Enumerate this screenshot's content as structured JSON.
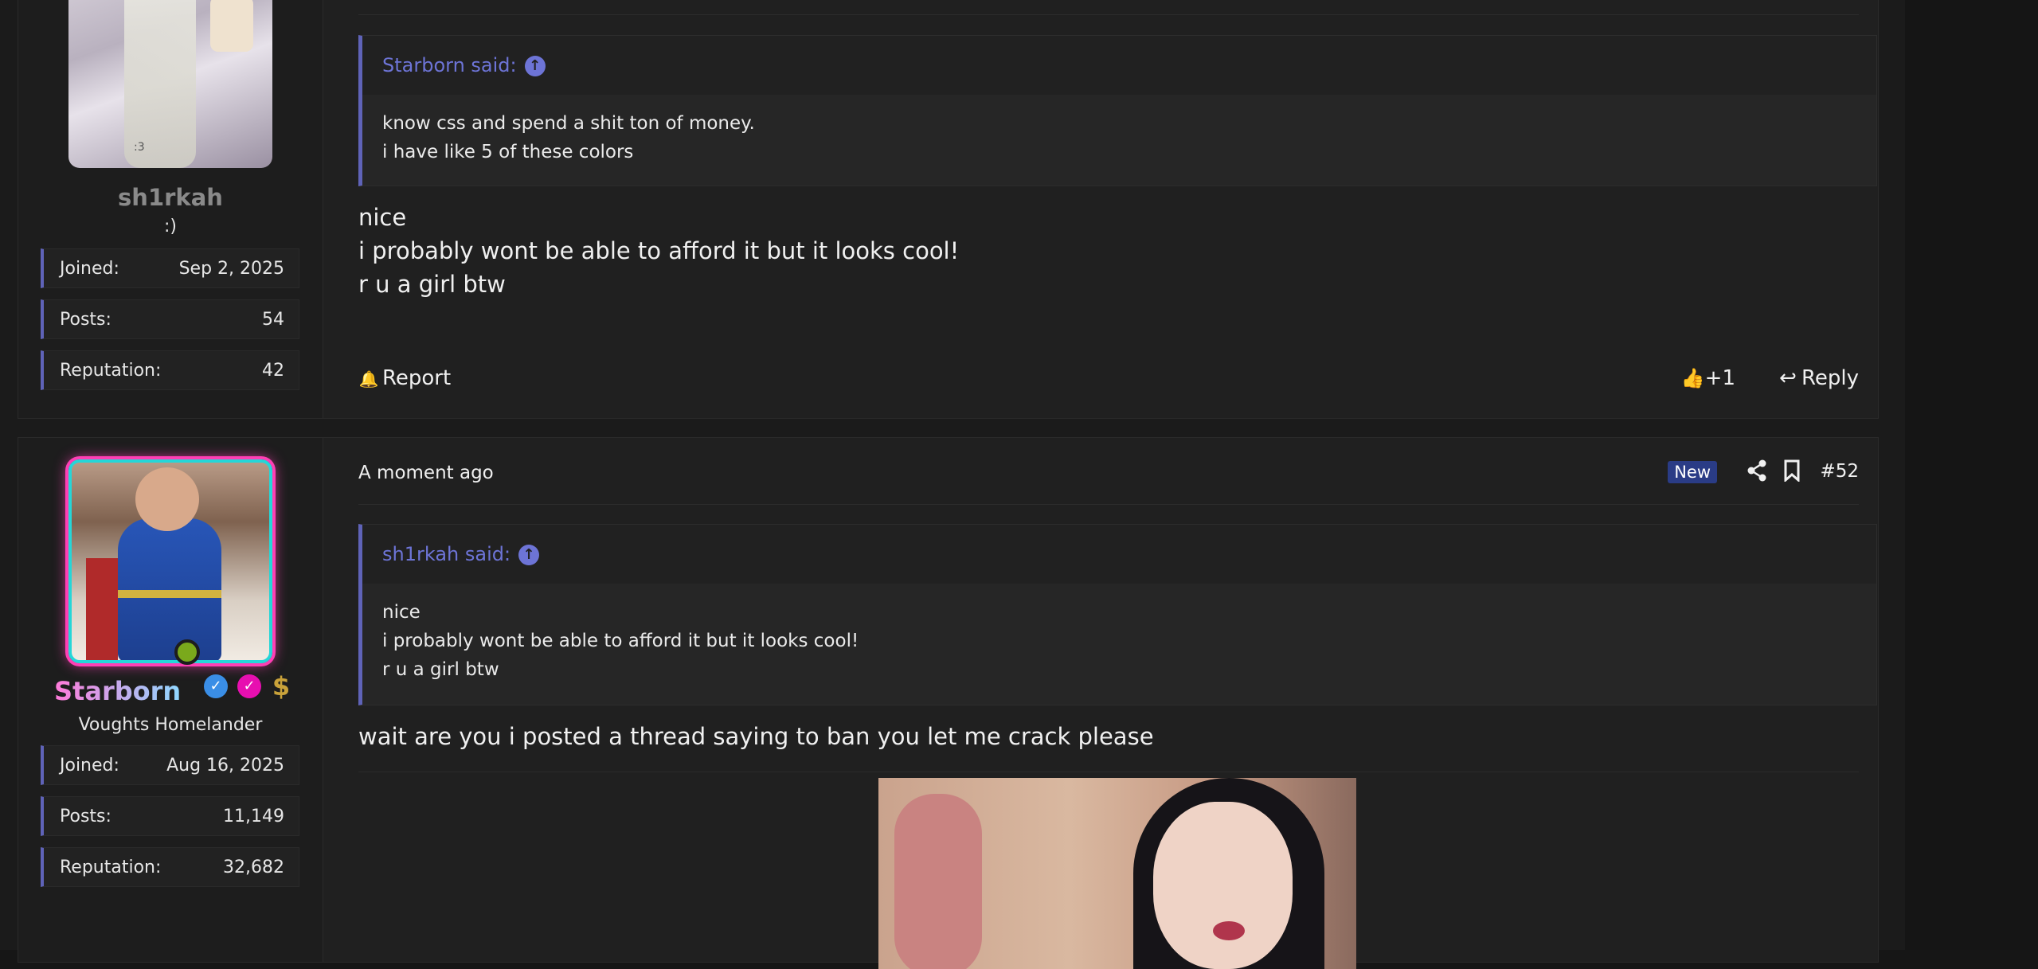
{
  "posts": [
    {
      "user": {
        "name": "sh1rkah",
        "title": ":)",
        "stats": [
          {
            "label": "Joined:",
            "value": "Sep 2, 2025"
          },
          {
            "label": "Posts:",
            "value": "54"
          },
          {
            "label": "Reputation:",
            "value": "42"
          }
        ]
      },
      "quote": {
        "author_line": "Starborn said:",
        "lines": [
          "know css and spend a shit ton of money.",
          "i have like 5 of these colors"
        ]
      },
      "message_lines": [
        "nice",
        "i probably wont be able to afford it but it looks cool!",
        "r u a girl btw"
      ],
      "actions": {
        "report": "Report",
        "like_count": "+1",
        "reply": "Reply"
      }
    },
    {
      "time": "A moment ago",
      "new_label": "New",
      "post_number": "#52",
      "user": {
        "name": "Starborn",
        "title": "Voughts Homelander",
        "stats": [
          {
            "label": "Joined:",
            "value": "Aug 16, 2025"
          },
          {
            "label": "Posts:",
            "value": "11,149"
          },
          {
            "label": "Reputation:",
            "value": "32,682"
          }
        ],
        "dollar_badge": "$"
      },
      "quote": {
        "author_line": "sh1rkah said:",
        "lines": [
          "nice",
          "i probably wont be able to afford it but it looks cool!",
          "r u a girl btw"
        ]
      },
      "message_lines": [
        "wait are you i posted a thread saying to ban you let me crack please"
      ]
    }
  ],
  "icons": {
    "quote_up": "↑",
    "report": "🔔",
    "like": "👍",
    "reply": "↩",
    "share": "share-icon",
    "bookmark": "bookmark-icon",
    "verify": "✓"
  },
  "avatar_1_caption": ":3",
  "colors": {
    "accent": "#5f63b8",
    "quote_author": "#6d74d6",
    "new_badge": "#2a3c86",
    "online": "#7aa91c"
  }
}
